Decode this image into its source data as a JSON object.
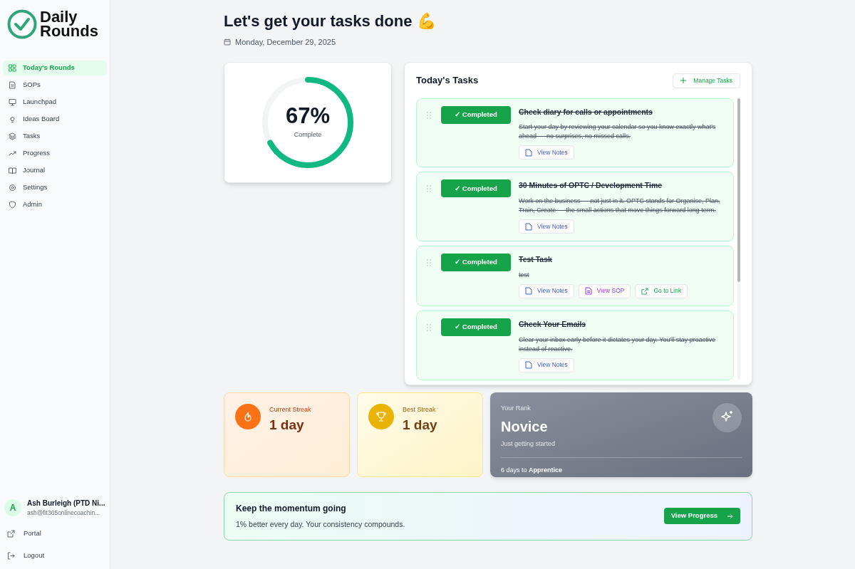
{
  "logo": {
    "line1": "Daily",
    "line2": "Rounds"
  },
  "sidebar": {
    "items": [
      {
        "label": "Today's Rounds",
        "selected": true
      },
      {
        "label": "SOPs",
        "selected": false
      },
      {
        "label": "Launchpad",
        "selected": false
      },
      {
        "label": "Ideas Board",
        "selected": false
      },
      {
        "label": "Tasks",
        "selected": false
      },
      {
        "label": "Progress",
        "selected": false
      },
      {
        "label": "Journal",
        "selected": false
      },
      {
        "label": "Settings",
        "selected": false
      },
      {
        "label": "Admin",
        "selected": false
      }
    ],
    "user": {
      "initial": "A",
      "name": "Ash Burleigh (PTD Ni...",
      "email": "ash@fit365onlinecoachin..."
    },
    "footer_items": [
      {
        "label": "Portal"
      },
      {
        "label": "Logout"
      }
    ]
  },
  "header": {
    "title": "Let's get your tasks done 💪",
    "date": "Monday, December 29, 2025"
  },
  "progress": {
    "level": 0.67,
    "percent": "67%",
    "caption": "Complete"
  },
  "tasks_panel": {
    "title": "Today's Tasks",
    "manage_button": "Manage Tasks",
    "tasks": [
      {
        "status": "✓ Completed",
        "completed": true,
        "title": "Check diary for calls or appointments",
        "description": "Start your day by reviewing your calendar so you know exactly what's ahead — no surprises, no missed calls.",
        "actions": [
          {
            "kind": "notes",
            "label": "View Notes"
          }
        ]
      },
      {
        "status": "✓ Completed",
        "completed": true,
        "title": "30 Minutes of OPTC / Development Time",
        "description": "Work on the business — not just in it. OPTC stands for Organise, Plan, Train, Create — the small actions that move things forward long term.",
        "actions": [
          {
            "kind": "notes",
            "label": "View Notes"
          }
        ]
      },
      {
        "status": "✓ Completed",
        "completed": true,
        "title": "Test Task",
        "description": "test",
        "actions": [
          {
            "kind": "notes",
            "label": "View Notes"
          },
          {
            "kind": "sop",
            "label": "View SOP"
          },
          {
            "kind": "link",
            "label": "Go to Link"
          }
        ]
      },
      {
        "status": "✓ Completed",
        "completed": true,
        "title": "Check Your Emails",
        "description": "Clear your inbox early before it dictates your day. You'll stay proactive instead of reactive.",
        "actions": [
          {
            "kind": "notes",
            "label": "View Notes"
          }
        ]
      }
    ]
  },
  "stats": [
    {
      "kind": "current",
      "label": "Current Streak",
      "value": "1 day"
    },
    {
      "kind": "best",
      "label": "Best Streak",
      "value": "1 day"
    }
  ],
  "rank": {
    "label": "Your Rank",
    "name": "Novice",
    "subtitle": "Just getting started",
    "next": "6 days to **Apprentice**"
  },
  "banner": {
    "title": "Keep the momentum going",
    "text": "1% better every day. Your consistency compounds.",
    "button": "View Progress"
  }
}
